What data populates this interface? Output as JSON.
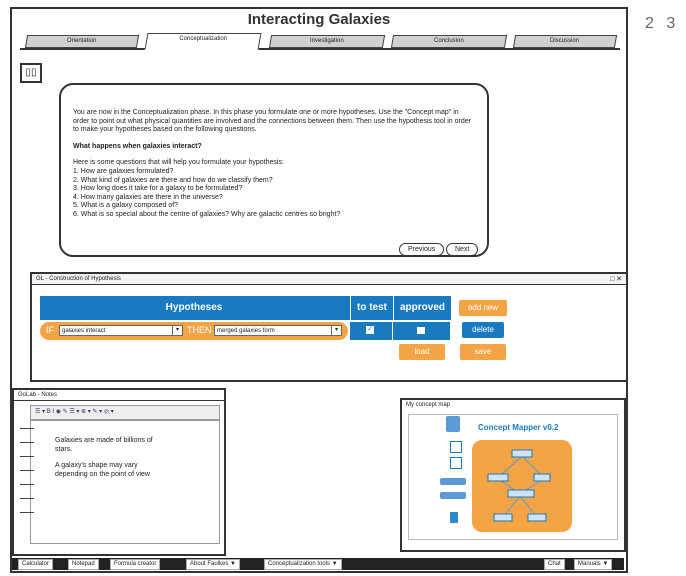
{
  "app": {
    "title": "Interacting Galaxies",
    "page_number": "2 3"
  },
  "tabs": [
    {
      "label": "Orientation"
    },
    {
      "label": "Conceptualization"
    },
    {
      "label": "Investigation"
    },
    {
      "label": "Conclusion"
    },
    {
      "label": "Discussion"
    }
  ],
  "intro": {
    "paragraph": "You are now in the Conceptualization phase. In this phase you formulate one or more hypotheses. Use the \"Concept map\" in order to point out what physical quantities are involved and the connections between them. Then use the hypothesis tool in order to make your hypotheses based on the following questions.",
    "question": "What happens when galaxies interact?",
    "lead": "Here is some questions that will help you formulate your hypothesis:",
    "items": [
      "1. How are galaxies formulated?",
      "2. What kind of galaxies are there and how do we classify them?",
      "3. How long does it take for a galaxy to be formulated?",
      "4. How many galaxies are there in the universe?",
      "5. What is a galaxy composed of?",
      "6. What is so special about the centre of galaxies? Why are galactic centres so bright?"
    ],
    "previous": "Previous",
    "next": "Next"
  },
  "hypothesis_tool": {
    "title": "GL - Construction of Hypothesis",
    "window_controls": "□ ✕",
    "col_hypotheses": "Hypotheses",
    "col_to_test": "to test",
    "col_approved": "approved",
    "add_new": "add new",
    "if_label": "IF",
    "if_value": "galaxies interact",
    "then_label": "THEN",
    "then_value": "merged galaxies form",
    "delete": "delete",
    "load": "load",
    "save": "save"
  },
  "notes": {
    "title": "GoLab - Notes",
    "toolbar": "☰ ▾ B I ◉ ✎ ☰ ▾ ≣ ▾ ✎ ▾ ◎ ▾",
    "line1": "Galaxies are made of billions of",
    "line2": "stars.",
    "line3": "A galaxy's shape may vary",
    "line4": "depending on the point of view"
  },
  "concept_map": {
    "title": "My concept map",
    "app_title": "Concept Mapper v0.2"
  },
  "bottom_bar": {
    "calculator": "Calculator",
    "notepad": "Notepad",
    "formula": "Formula creator",
    "faulkes": "About Faulkes ▼",
    "concept_tools": "Conceptualization tools ▼",
    "chat": "Chat",
    "manuals": "Manuals ▼"
  },
  "colors": {
    "accent_blue": "#1a7abf",
    "accent_orange": "#f5a445"
  }
}
